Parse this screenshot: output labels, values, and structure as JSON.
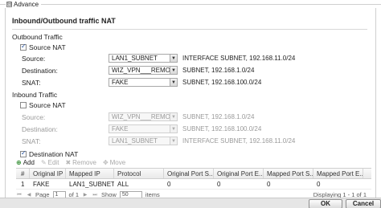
{
  "advance": {
    "toggle_symbol": "⊟",
    "label": "Advance"
  },
  "section_title": "Inbound/Outbound traffic NAT",
  "outbound": {
    "group_label": "Outbound Traffic",
    "source_nat": {
      "label": "Source NAT",
      "checked": true
    },
    "source": {
      "label": "Source:",
      "value": "LAN1_SUBNET",
      "desc": "INTERFACE SUBNET, 192.168.11.0/24"
    },
    "destination": {
      "label": "Destination:",
      "value": "WIZ_VPN___REMOTE",
      "desc": "SUBNET, 192.168.1.0/24"
    },
    "snat": {
      "label": "SNAT:",
      "value": "FAKE",
      "desc": "SUBNET, 192.168.100.0/24"
    }
  },
  "inbound": {
    "group_label": "Inbound Traffic",
    "source_nat": {
      "label": "Source NAT",
      "checked": false
    },
    "source": {
      "label": "Source:",
      "value": "WIZ_VPN___REMOTE",
      "desc": "SUBNET, 192.168.1.0/24"
    },
    "destination": {
      "label": "Destination:",
      "value": "FAKE",
      "desc": "SUBNET, 192.168.100.0/24"
    },
    "snat": {
      "label": "SNAT:",
      "value": "LAN1_SUBNET",
      "desc": "INTERFACE SUBNET, 192.168.11.0/24"
    }
  },
  "destination_nat": {
    "label": "Destination NAT",
    "checked": true,
    "toolbar": {
      "add": "Add",
      "edit": "Edit",
      "remove": "Remove",
      "move": "Move"
    },
    "columns": [
      "#",
      "Original IP",
      "Mapped IP",
      "Protocol",
      "Original Port S...",
      "Original Port E...",
      "Mapped Port S...",
      "Mapped Port E..."
    ],
    "rows": [
      [
        "1",
        "FAKE",
        "LAN1_SUBNET",
        "ALL",
        "0",
        "0",
        "0",
        "0"
      ]
    ],
    "pager": {
      "page_label": "Page",
      "page_value": "1",
      "of_label": "of 1",
      "show_label": "Show",
      "show_value": "50",
      "items_label": "items",
      "displaying": "Displaying 1 - 1 of 1"
    }
  },
  "footer": {
    "ok": "OK",
    "cancel": "Cancel"
  }
}
